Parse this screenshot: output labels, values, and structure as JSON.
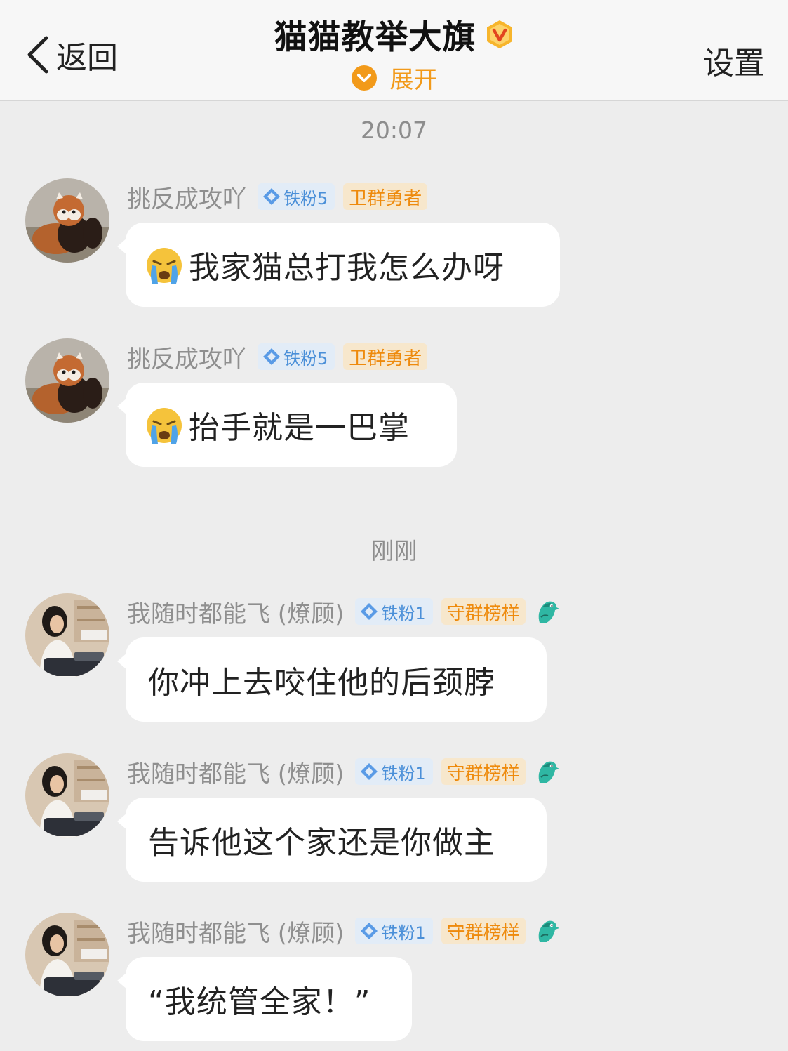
{
  "header": {
    "back_label": "返回",
    "title": "猫猫教举大旗",
    "expand_label": "展开",
    "settings_label": "设置"
  },
  "colors": {
    "accent": "#f29a1a",
    "fan_badge": "#4a8fd8",
    "title_badge": "#ee8a0c",
    "background": "#ededed"
  },
  "dividers": [
    "20:07",
    "刚刚"
  ],
  "messages": [
    {
      "sender": "挑反成攻吖",
      "fan_badge": "铁粉5",
      "title_badge": "卫群勇者",
      "emoji": "loudly-crying-face-icon",
      "text": "我家猫总打我怎么办呀",
      "avatar": "red-panda-avatar"
    },
    {
      "sender": "挑反成攻吖",
      "fan_badge": "铁粉5",
      "title_badge": "卫群勇者",
      "emoji": "loudly-crying-face-icon",
      "text": "抬手就是一巴掌",
      "avatar": "red-panda-avatar"
    },
    {
      "sender": "我随时都能飞 (燎顾)",
      "fan_badge": "铁粉1",
      "title_badge": "守群榜样",
      "extra_icon": "bird-badge-icon",
      "text": "你冲上去咬住他的后颈脖",
      "avatar": "girl-at-laptop-avatar"
    },
    {
      "sender": "我随时都能飞 (燎顾)",
      "fan_badge": "铁粉1",
      "title_badge": "守群榜样",
      "extra_icon": "bird-badge-icon",
      "text": "告诉他这个家还是你做主",
      "avatar": "girl-at-laptop-avatar"
    },
    {
      "sender": "我随时都能飞 (燎顾)",
      "fan_badge": "铁粉1",
      "title_badge": "守群榜样",
      "extra_icon": "bird-badge-icon",
      "text": "“我统管全家！”",
      "avatar": "girl-at-laptop-avatar"
    }
  ]
}
